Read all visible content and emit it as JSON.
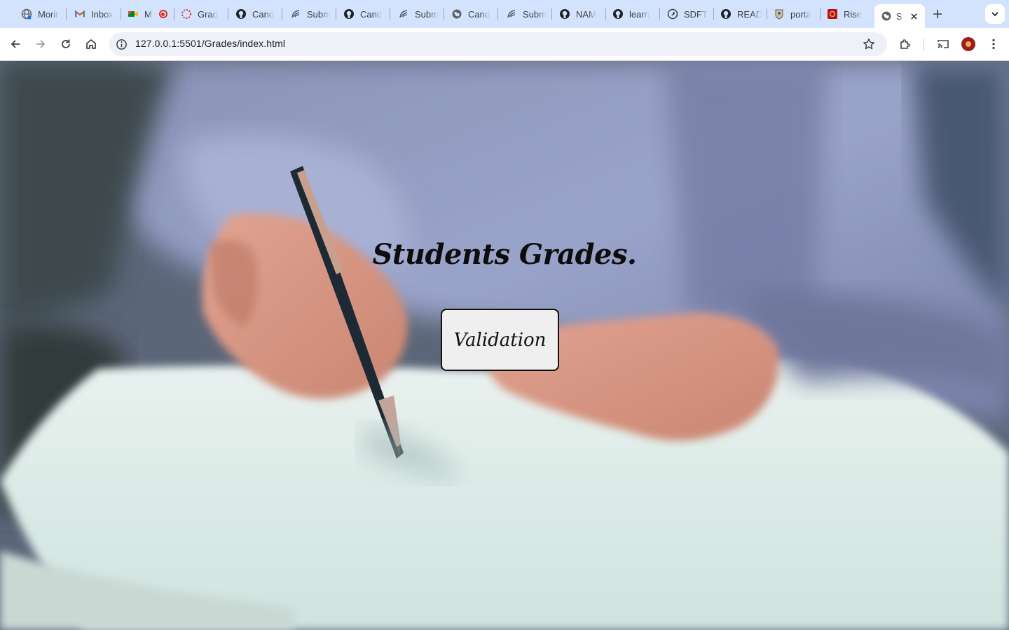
{
  "browser": {
    "tabs": [
      {
        "title": "Morir",
        "icon": "globe-icon"
      },
      {
        "title": "Inbox",
        "icon": "gmail-icon"
      },
      {
        "title": "M",
        "icon": "meet-icon"
      },
      {
        "title": "Grad",
        "icon": "loading-ring-icon"
      },
      {
        "title": "Cand",
        "icon": "github-icon"
      },
      {
        "title": "Subm",
        "icon": "moringa-icon"
      },
      {
        "title": "Cand",
        "icon": "github-icon"
      },
      {
        "title": "Subm",
        "icon": "moringa-icon"
      },
      {
        "title": "Cand",
        "icon": "globe-icon"
      },
      {
        "title": "Subm",
        "icon": "moringa-icon"
      },
      {
        "title": "NAM",
        "icon": "github-icon"
      },
      {
        "title": "learn",
        "icon": "github-icon"
      },
      {
        "title": "SDFT",
        "icon": "rocket-icon"
      },
      {
        "title": "READ",
        "icon": "github-icon"
      },
      {
        "title": "porta",
        "icon": "crest-icon"
      },
      {
        "title": "Rise",
        "icon": "rise-icon"
      }
    ],
    "active_tab": {
      "title": "S",
      "icon": "globe-icon"
    },
    "url": "127.0.0.1:5501/Grades/index.html",
    "colors": {
      "tabstrip": "#d3e3fd",
      "toolbar": "#ffffff",
      "omnibox": "#eef1f7"
    }
  },
  "page": {
    "heading": "Students Grades.",
    "button_label": "Validation"
  }
}
